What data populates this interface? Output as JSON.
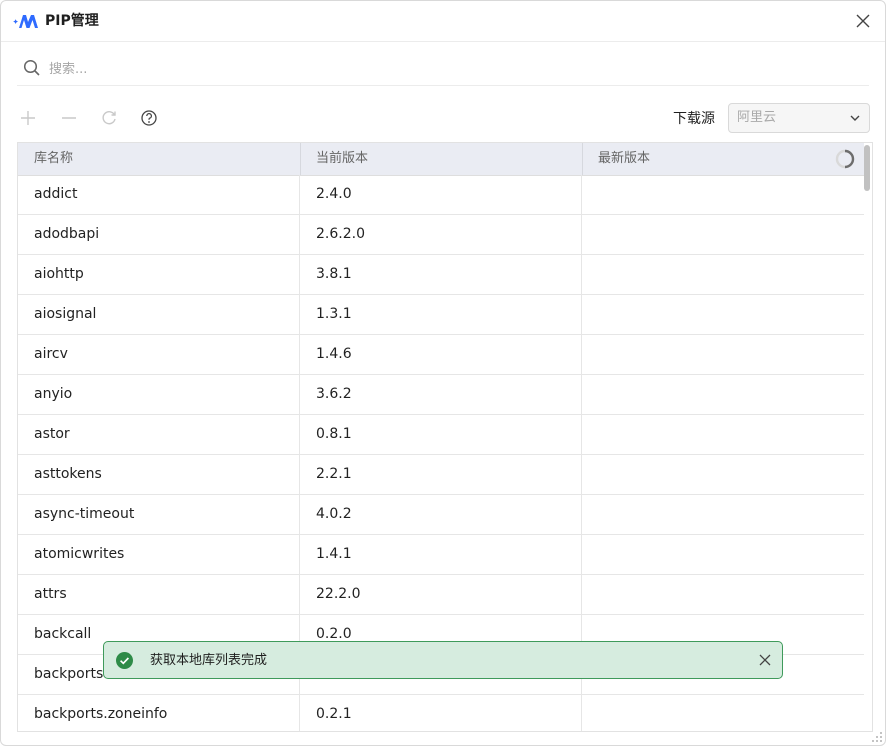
{
  "window": {
    "title": "PIP管理"
  },
  "search": {
    "placeholder": "搜索..."
  },
  "toolbar": {
    "add_icon": "plus-icon",
    "remove_icon": "minus-icon",
    "refresh_icon": "refresh-icon",
    "help_icon": "help-icon",
    "source_label": "下载源",
    "source_value": "阿里云"
  },
  "table": {
    "columns": [
      "库名称",
      "当前版本",
      "最新版本"
    ],
    "rows": [
      {
        "name": "addict",
        "version": "2.4.0",
        "latest": ""
      },
      {
        "name": "adodbapi",
        "version": "2.6.2.0",
        "latest": ""
      },
      {
        "name": "aiohttp",
        "version": "3.8.1",
        "latest": ""
      },
      {
        "name": "aiosignal",
        "version": "1.3.1",
        "latest": ""
      },
      {
        "name": "aircv",
        "version": "1.4.6",
        "latest": ""
      },
      {
        "name": "anyio",
        "version": "3.6.2",
        "latest": ""
      },
      {
        "name": "astor",
        "version": "0.8.1",
        "latest": ""
      },
      {
        "name": "asttokens",
        "version": "2.2.1",
        "latest": ""
      },
      {
        "name": "async-timeout",
        "version": "4.0.2",
        "latest": ""
      },
      {
        "name": "atomicwrites",
        "version": "1.4.1",
        "latest": ""
      },
      {
        "name": "attrs",
        "version": "22.2.0",
        "latest": ""
      },
      {
        "name": "backcall",
        "version": "0.2.0",
        "latest": ""
      },
      {
        "name": "backports-",
        "version": "",
        "latest": ""
      },
      {
        "name": "backports.zoneinfo",
        "version": "0.2.1",
        "latest": ""
      }
    ]
  },
  "toast": {
    "message": "获取本地库列表完成"
  },
  "colors": {
    "accent": "#2f6bff",
    "toast_bg": "#d6ecdf",
    "toast_border": "#3f9a5b",
    "success_icon": "#2e8b48",
    "header_bg": "#eaecf3"
  }
}
